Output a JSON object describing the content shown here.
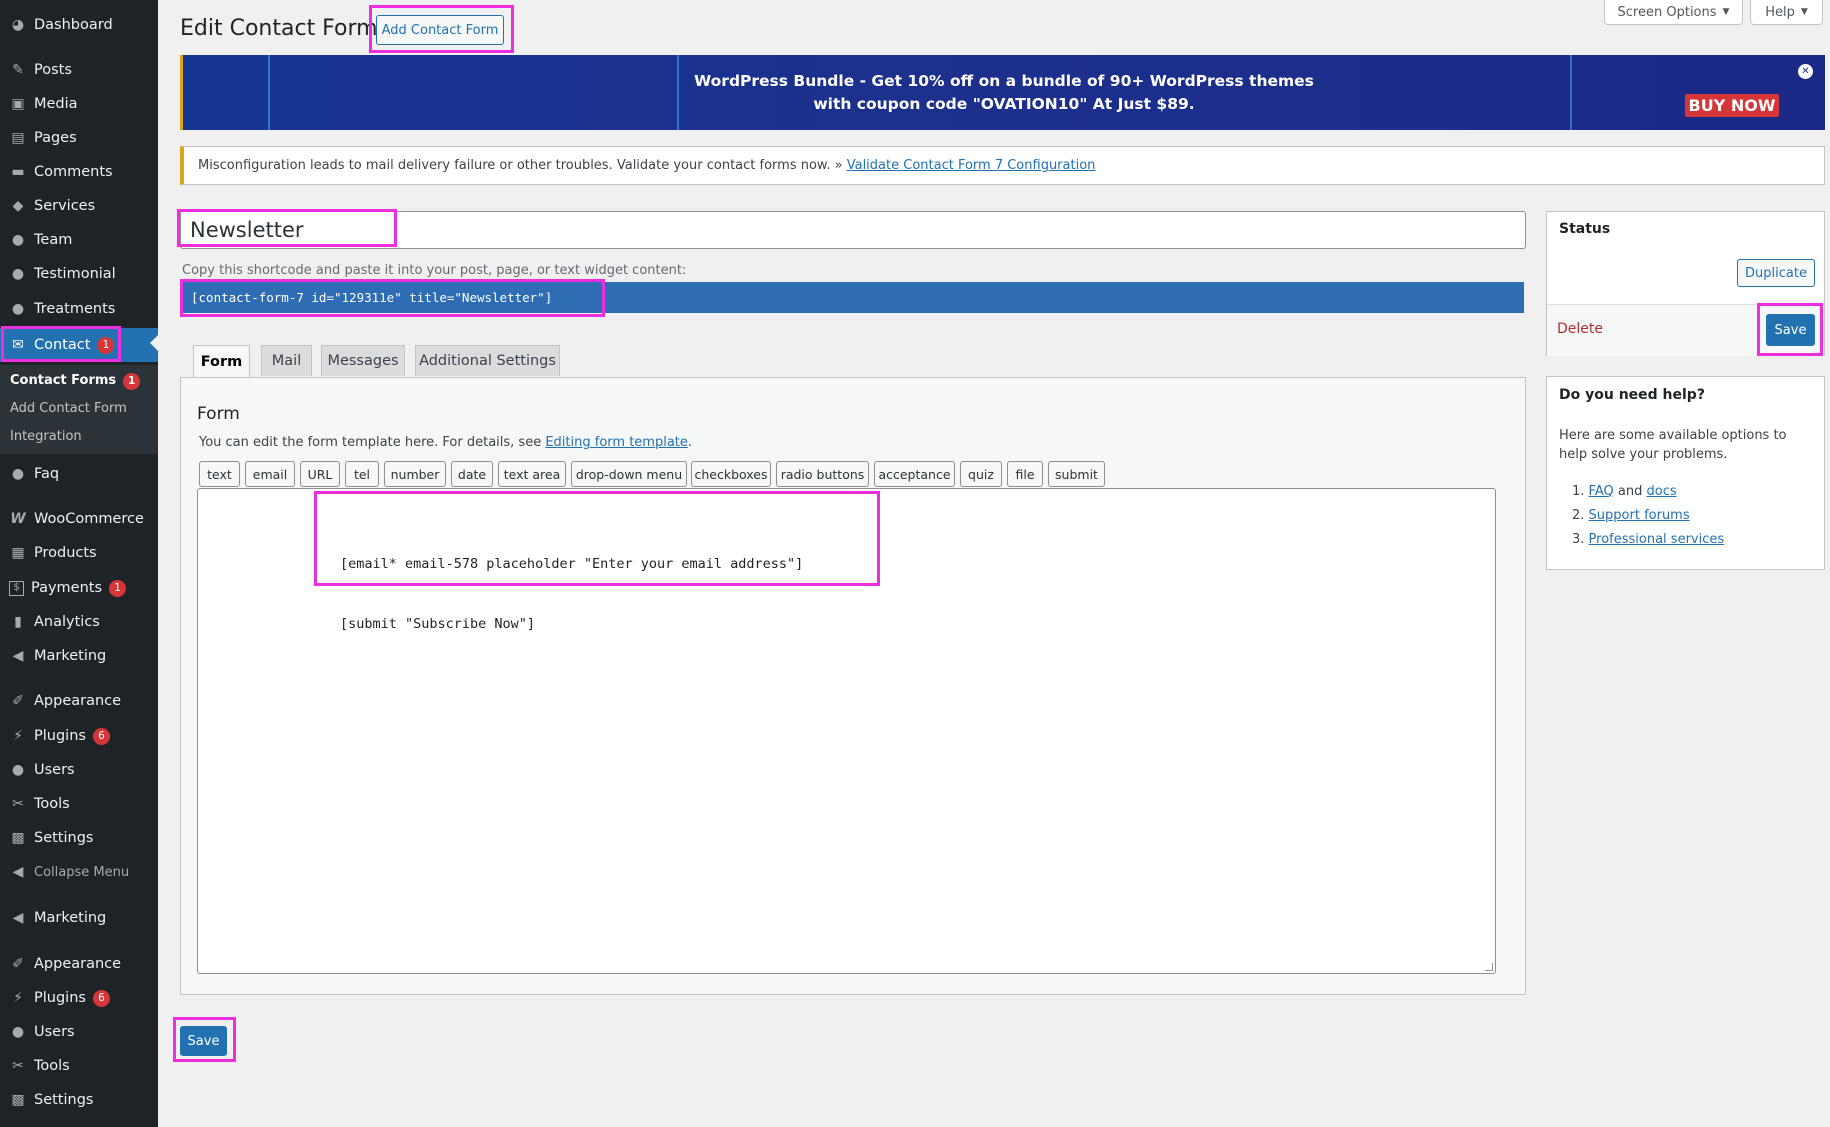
{
  "sidebar": {
    "dashboard": "Dashboard",
    "posts": "Posts",
    "media": "Media",
    "pages": "Pages",
    "comments": "Comments",
    "services": "Services",
    "team": "Team",
    "testimonial": "Testimonial",
    "treatments": "Treatments",
    "contact": "Contact",
    "contact_badge": "1",
    "sub_contact_forms": "Contact Forms",
    "sub_contact_forms_badge": "1",
    "sub_add_contact_form": "Add Contact Form",
    "sub_integration": "Integration",
    "faq": "Faq",
    "woocommerce": "WooCommerce",
    "products": "Products",
    "payments": "Payments",
    "payments_badge": "1",
    "analytics": "Analytics",
    "marketing": "Marketing",
    "appearance": "Appearance",
    "plugins": "Plugins",
    "plugins_badge": "6",
    "users": "Users",
    "tools": "Tools",
    "settings": "Settings",
    "collapse": "Collapse Menu",
    "marketing2": "Marketing",
    "appearance2": "Appearance",
    "plugins2": "Plugins",
    "plugins2_badge": "6",
    "users2": "Users",
    "tools2": "Tools",
    "settings2": "Settings"
  },
  "header": {
    "title": "Edit Contact Form",
    "add_button": "Add Contact Form",
    "screen_options": "Screen Options",
    "help": "Help"
  },
  "banner": {
    "line1": "WordPress Bundle - Get 10% off on a bundle of 90+ WordPress themes",
    "line2": "with coupon code \"OVATION10\" At Just $89.",
    "buy_now": "BUY NOW"
  },
  "notice": {
    "text": "Misconfiguration leads to mail delivery failure or other troubles. Validate your contact forms now. »",
    "link": "Validate Contact Form 7 Configuration"
  },
  "form_title": "Newsletter",
  "shortcode": {
    "label": "Copy this shortcode and paste it into your post, page, or text widget content:",
    "value": "[contact-form-7 id=\"129311e\" title=\"Newsletter\"]"
  },
  "tabs": [
    "Form",
    "Mail",
    "Messages",
    "Additional Settings"
  ],
  "form_panel": {
    "heading": "Form",
    "desc": "You can edit the form template here. For details, see",
    "desc_link": "Editing form template",
    "desc_end": ".",
    "tag_buttons": [
      "text",
      "email",
      "URL",
      "tel",
      "number",
      "date",
      "text area",
      "drop-down menu",
      "checkboxes",
      "radio buttons",
      "acceptance",
      "quiz",
      "file",
      "submit"
    ],
    "template_line1": "[email* email-578 placeholder \"Enter your email address\"]",
    "template_line2": "[submit \"Subscribe Now\"]"
  },
  "status_box": {
    "title": "Status",
    "duplicate": "Duplicate",
    "delete": "Delete",
    "save": "Save"
  },
  "help_box": {
    "title": "Do you need help?",
    "text": "Here are some available options to help solve your problems.",
    "n1": "1.",
    "faq": "FAQ",
    "and": "and",
    "docs": "docs",
    "n2": "2.",
    "support": "Support forums",
    "n3": "3.",
    "professional": "Professional services"
  },
  "bottom_save": "Save",
  "colors": {
    "sidebar_bg": "#1d2327",
    "accent": "#2271b1",
    "highlight": "#ee2ce0",
    "badge": "#d63638",
    "banner_bg": "#1a2d8f",
    "notice_border": "#dba617"
  }
}
